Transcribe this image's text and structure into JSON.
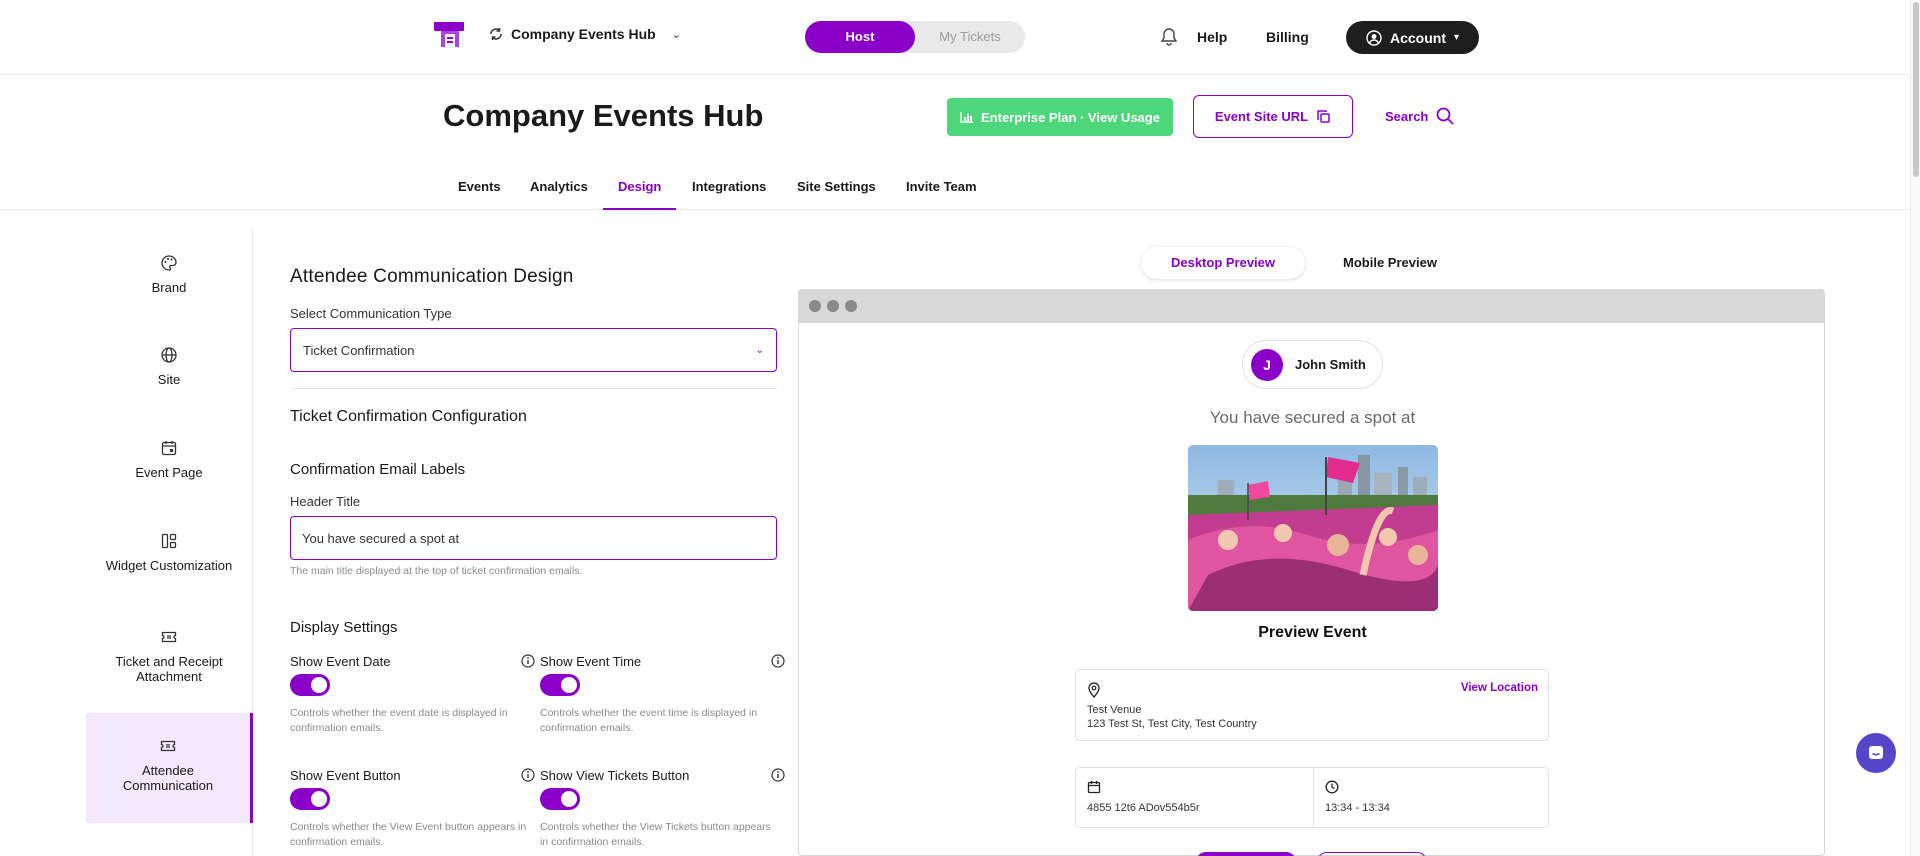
{
  "topbar": {
    "hub_name": "Company Events Hub",
    "segment": {
      "host": "Host",
      "my_tickets": "My Tickets"
    },
    "help": "Help",
    "billing": "Billing",
    "account": "Account"
  },
  "header": {
    "title": "Company Events Hub",
    "enterprise": "Enterprise Plan · View Usage",
    "site_url": "Event Site URL",
    "search": "Search"
  },
  "tabs": [
    "Events",
    "Analytics",
    "Design",
    "Integrations",
    "Site Settings",
    "Invite Team"
  ],
  "active_tab": "Design",
  "sidebar": [
    {
      "label": "Brand",
      "icon": "palette-icon"
    },
    {
      "label": "Site",
      "icon": "globe-icon"
    },
    {
      "label": "Event Page",
      "icon": "calendar-icon"
    },
    {
      "label": "Widget Customization",
      "icon": "layout-icon"
    },
    {
      "label": "Ticket and Receipt Attachment",
      "icon": "ticket-icon"
    },
    {
      "label": "Attendee Communication",
      "icon": "ticket-icon",
      "active": true
    }
  ],
  "form": {
    "heading": "Attendee Communication Design",
    "type_label": "Select Communication Type",
    "type_value": "Ticket Confirmation",
    "config_heading": "Ticket Confirmation Configuration",
    "labels_heading": "Confirmation Email Labels",
    "header_title_label": "Header Title",
    "header_title_value": "You have secured a spot at",
    "header_title_help": "The main title displayed at the top of ticket confirmation emails.",
    "display_heading": "Display Settings",
    "settings": [
      {
        "title": "Show Event Date",
        "desc": "Controls whether the event date is displayed in confirmation emails.",
        "on": true
      },
      {
        "title": "Show Event Time",
        "desc": "Controls whether the event time is displayed in confirmation emails.",
        "on": true
      },
      {
        "title": "Show Event Button",
        "desc": "Controls whether the View Event button appears in confirmation emails.",
        "on": true
      },
      {
        "title": "Show View Tickets Button",
        "desc": "Controls whether the View Tickets button appears in confirmation emails.",
        "on": true
      }
    ]
  },
  "preview": {
    "tabs": {
      "desktop": "Desktop Preview",
      "mobile": "Mobile Preview"
    },
    "user_initial": "J",
    "user_name": "John Smith",
    "secured_text": "You have secured a spot at",
    "event_name": "Preview Event",
    "view_location": "View Location",
    "venue_name": "Test Venue",
    "venue_address": "123 Test St, Test City, Test Country",
    "date_value": "4855 12t6 ADov554b5r",
    "time_value": "13:34 - 13:34"
  },
  "colors": {
    "accent": "#8a00c8",
    "enterprise": "#4ed67a",
    "account_bg": "#1e1e1e",
    "chat": "#5546c9"
  }
}
